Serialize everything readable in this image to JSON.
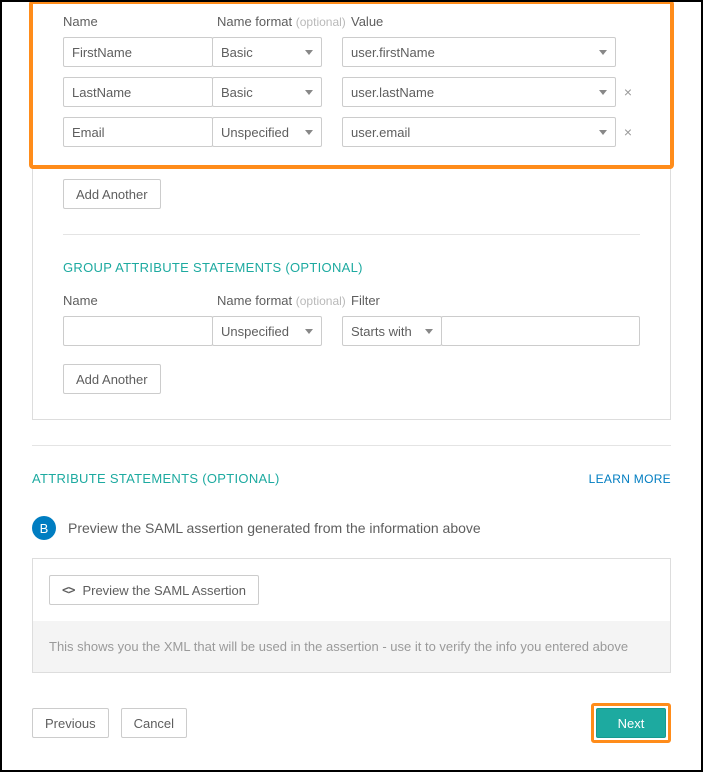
{
  "headers": {
    "name": "Name",
    "format": "Name format",
    "format_optional": "(optional)",
    "value": "Value",
    "filter": "Filter"
  },
  "attrs": [
    {
      "name": "FirstName",
      "format": "Basic",
      "value": "user.firstName",
      "removable": false
    },
    {
      "name": "LastName",
      "format": "Basic",
      "value": "user.lastName",
      "removable": true
    },
    {
      "name": "Email",
      "format": "Unspecified",
      "value": "user.email",
      "removable": true
    }
  ],
  "buttons": {
    "add_another": "Add Another",
    "previous": "Previous",
    "cancel": "Cancel",
    "next": "Next",
    "preview": "Preview the SAML Assertion"
  },
  "sections": {
    "group_title": "GROUP ATTRIBUTE STATEMENTS (OPTIONAL)",
    "attr_title": "ATTRIBUTE STATEMENTS (OPTIONAL)",
    "learn_more": "LEARN MORE"
  },
  "group": {
    "name": "",
    "format": "Unspecified",
    "filter_op": "Starts with",
    "filter_value": ""
  },
  "preview": {
    "step_letter": "B",
    "step_text": "Preview the SAML assertion generated from the information above",
    "hint": "This shows you the XML that will be used in the assertion - use it to verify the info you entered above"
  }
}
